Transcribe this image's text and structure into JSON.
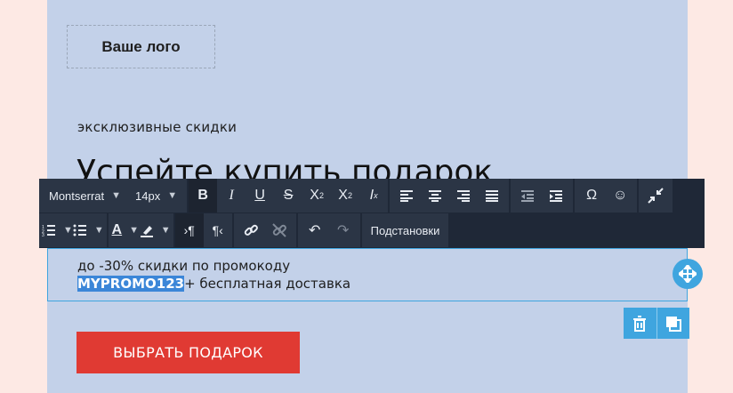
{
  "page": {
    "logo_text": "Ваше лого",
    "subtitle": "эксклюзивные скидки",
    "headline": "Успейте купить подарок",
    "promo_line1": "до -30% скидки по промокоду",
    "promo_code": "MYPROMO123",
    "promo_line2_rest": "+ бесплатная доставка",
    "cta_label": "ВЫБРАТЬ ПОДАРОК"
  },
  "toolbar": {
    "font_family": "Montserrat",
    "font_size": "14px",
    "substitutions_label": "Подстановки",
    "icons_row1": [
      "bold-icon",
      "italic-icon",
      "underline-icon",
      "strikethrough-icon",
      "superscript-icon",
      "subscript-icon",
      "clear-format-icon",
      "align-left-icon",
      "align-center-icon",
      "align-right-icon",
      "align-justify-icon",
      "outdent-icon",
      "indent-icon",
      "special-char-icon",
      "emoji-icon",
      "collapse-icon"
    ],
    "icons_row2": [
      "ordered-list-icon",
      "unordered-list-icon",
      "text-color-icon",
      "highlight-color-icon",
      "ltr-icon",
      "rtl-icon",
      "link-icon",
      "unlink-icon",
      "undo-icon",
      "redo-icon"
    ]
  },
  "colors": {
    "page_bg": "#fde9e4",
    "canvas_bg": "#c3d1e9",
    "toolbar_bg": "#1f2837",
    "accent": "#3fa5df",
    "cta_bg": "#e03a33",
    "highlight": "#3b86d8"
  }
}
